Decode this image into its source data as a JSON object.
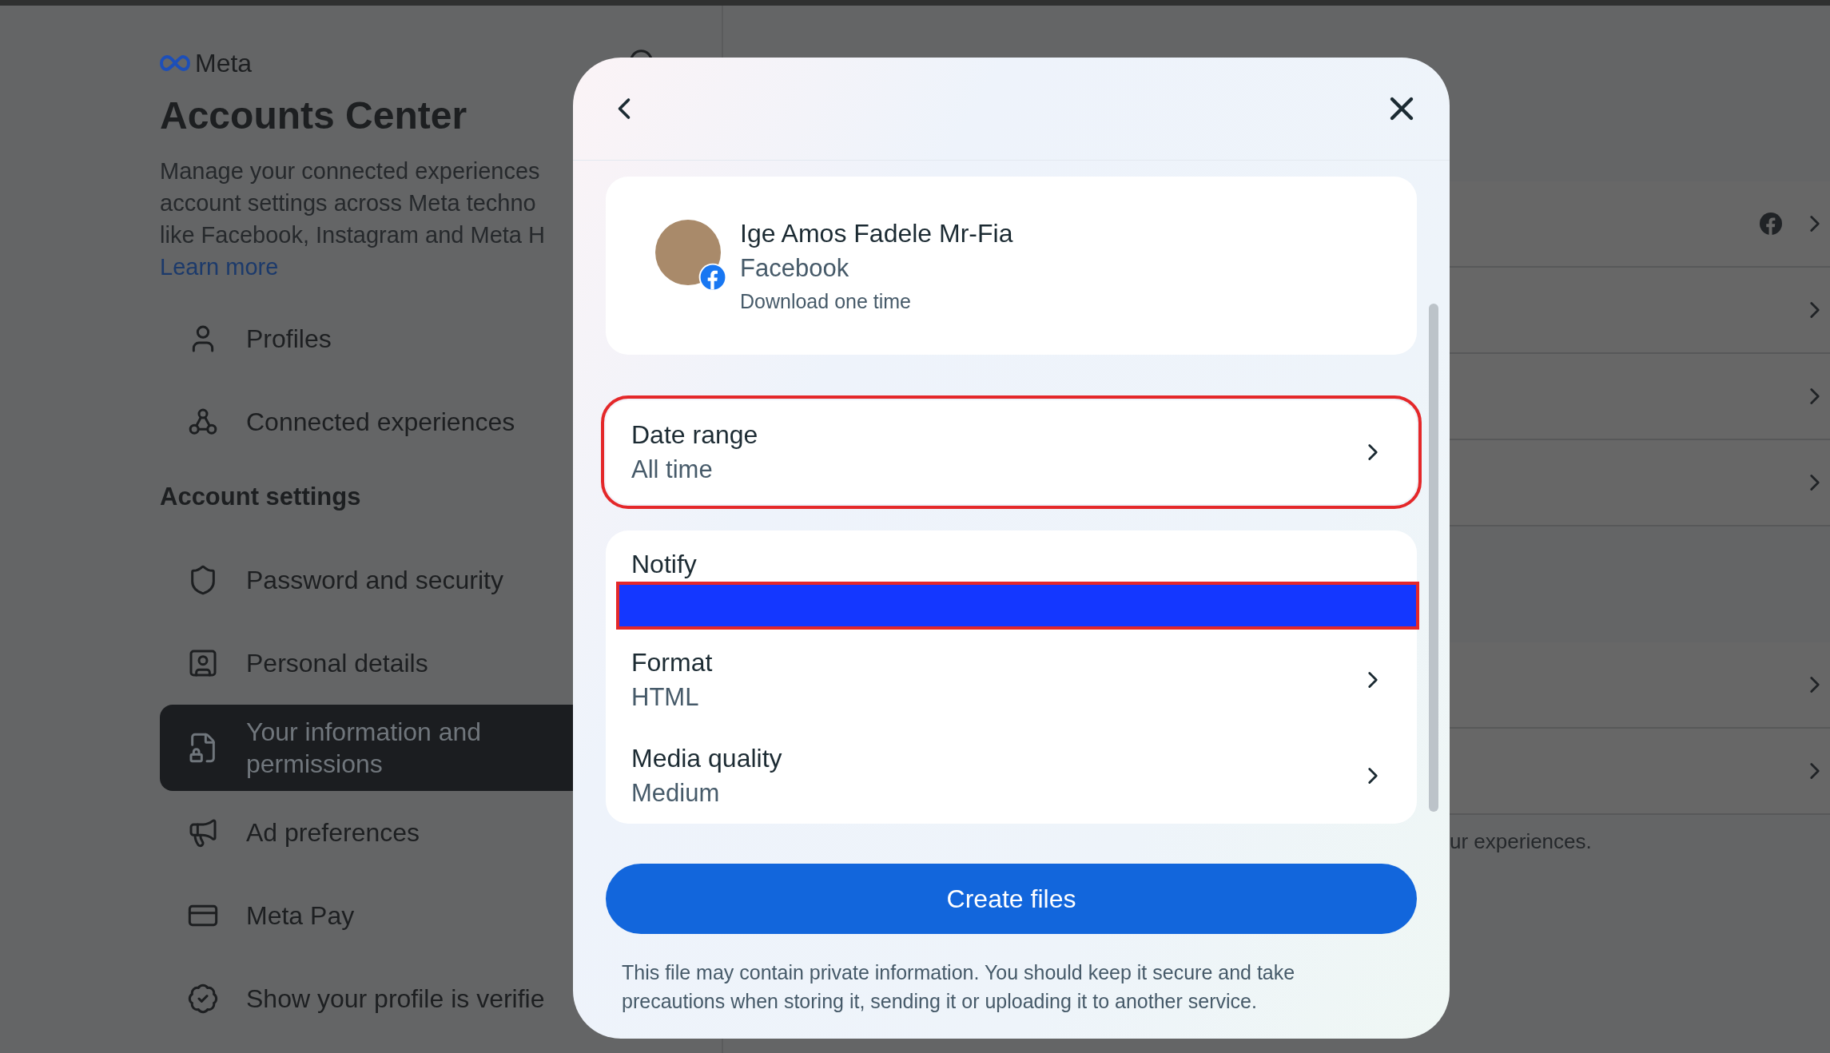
{
  "brand": {
    "name": "Meta"
  },
  "title": "Accounts Center",
  "description_lines": [
    "Manage your connected experiences",
    "account settings across Meta techno",
    "like Facebook, Instagram and Meta H"
  ],
  "learn_more": "Learn more",
  "nav_top": [
    {
      "label": "Profiles",
      "kind": "person",
      "selected": false
    },
    {
      "label": "Connected experiences",
      "kind": "connected",
      "selected": false
    }
  ],
  "section_heading": "Account settings",
  "nav_settings": [
    {
      "label": "Password and security",
      "kind": "shield",
      "selected": false
    },
    {
      "label": "Personal details",
      "kind": "idcard",
      "selected": false
    },
    {
      "label": "Your information and permissions",
      "kind": "infolock",
      "selected": true
    },
    {
      "label": "Ad preferences",
      "kind": "megaphone",
      "selected": false
    },
    {
      "label": "Meta Pay",
      "kind": "card",
      "selected": false
    },
    {
      "label": "Show your profile is verifie",
      "kind": "verified",
      "selected": false
    }
  ],
  "right_panel": {
    "groups": [
      {
        "rows": [
          {
            "facebook_icon": true
          },
          {
            "facebook_icon": false
          },
          {
            "facebook_icon": false
          },
          {
            "facebook_icon": false
          }
        ]
      },
      {
        "rows": [
          {
            "facebook_icon": false
          },
          {
            "facebook_icon": false
          }
        ]
      }
    ],
    "footer_text": "ur experiences."
  },
  "modal": {
    "profile": {
      "name": "Ige Amos Fadele Mr-Fia",
      "platform": "Facebook",
      "note": "Download one time"
    },
    "option_groups": [
      [
        {
          "label": "Date range",
          "value": "All time",
          "highlighted": true,
          "redacted": false
        }
      ],
      [
        {
          "label": "Notify",
          "highlighted": false,
          "redacted": true
        },
        {
          "label": "Format",
          "value": "HTML",
          "highlighted": false,
          "redacted": false
        },
        {
          "label": "Media quality",
          "value": "Medium",
          "highlighted": false,
          "redacted": false
        }
      ]
    ],
    "primary_button": "Create files",
    "disclaimer": "This file may contain private information. You should keep it secure and take precautions when storing it, sending it or uploading it to another service."
  }
}
